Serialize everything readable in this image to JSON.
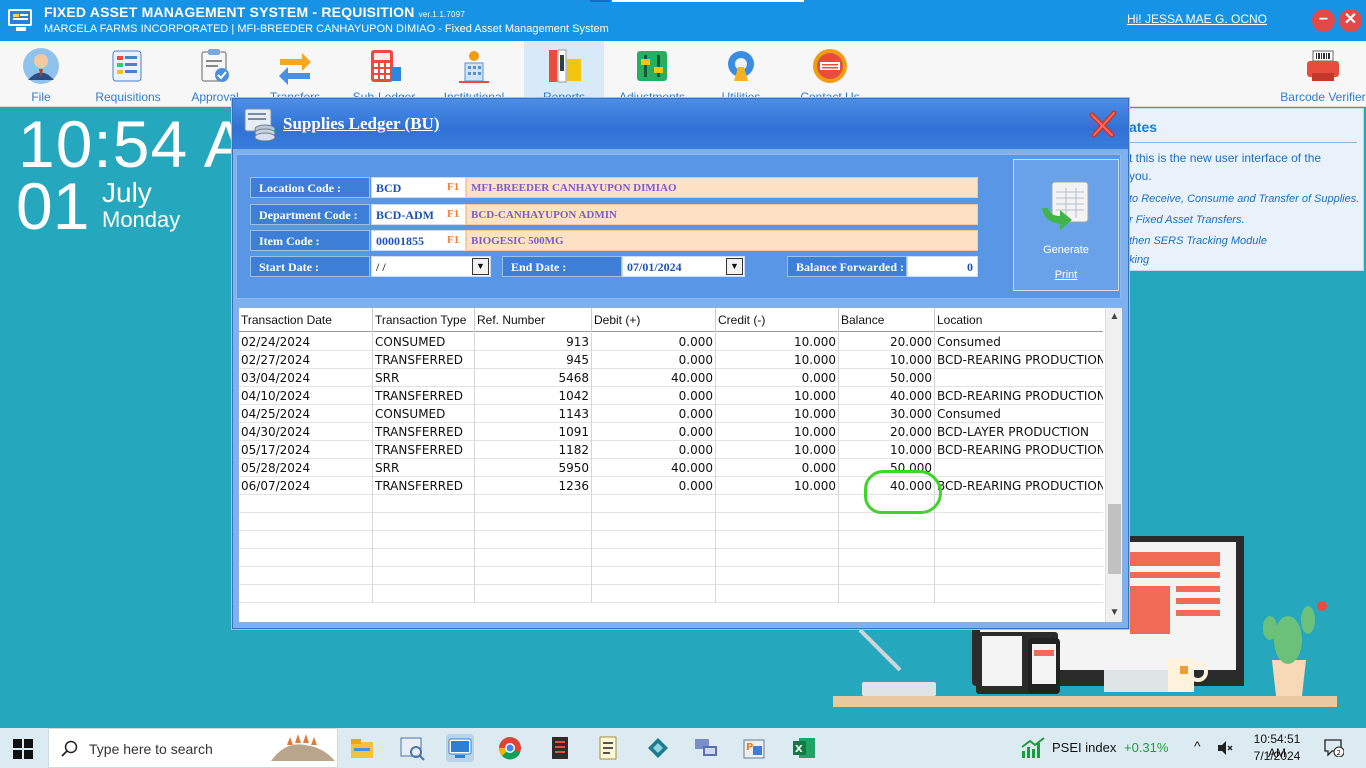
{
  "app": {
    "title": "FIXED ASSET MANAGEMENT SYSTEM - REQUISITION",
    "version": "ver.1.1.7097",
    "subtitle": "MARCELA FARMS INCORPORATED | MFI-BREEDER CANHAYUPON DIMIAO - Fixed Asset Management System",
    "user_greeting": "Hi! JESSA MAE G. OCNO",
    "minimize_label": "−",
    "close_label": "✕"
  },
  "ribbon": [
    {
      "label": "File",
      "icon": "user-icon"
    },
    {
      "label": "Requisitions",
      "icon": "requisition-icon"
    },
    {
      "label": "Approval",
      "icon": "approval-icon"
    },
    {
      "label": "Transfers",
      "icon": "transfer-icon"
    },
    {
      "label": "Sub-Ledger",
      "icon": "calculator-icon"
    },
    {
      "label": "Institutional",
      "icon": "institution-icon"
    },
    {
      "label": "Reports",
      "icon": "reports-icon",
      "active": true
    },
    {
      "label": "Adjustments",
      "icon": "adjustments-icon"
    },
    {
      "label": "Utilities",
      "icon": "utilities-icon"
    },
    {
      "label": "Contact Us",
      "icon": "contact-icon"
    },
    {
      "label": "Barcode Verifier",
      "icon": "barcode-printer-icon"
    }
  ],
  "clock": {
    "time": "10:54 A",
    "day": "01",
    "month": "July",
    "weekday": "Monday"
  },
  "updates": {
    "title": "ates",
    "lines": [
      "t this is the new user interface of  the",
      "you.",
      "to Receive, Consume and Transfer of Supplies.",
      "r Fixed Asset Transfers.",
      "then SERS Tracking Module",
      "king"
    ]
  },
  "dialog": {
    "title": "Supplies Ledger (BU)",
    "location": {
      "label": "Location Code :",
      "code": "BCD",
      "key": "F1",
      "desc": "MFI-BREEDER CANHAYUPON DIMIAO"
    },
    "department": {
      "label": "Department Code :",
      "code": "BCD-ADM",
      "key": "F1",
      "desc": "BCD-CANHAYUPON ADMIN"
    },
    "item": {
      "label": "Item Code :",
      "code": "00001855",
      "key": "F1",
      "desc": "BIOGESIC 500MG"
    },
    "start_date": {
      "label": "Start Date :",
      "value": " /  /"
    },
    "end_date": {
      "label": "End Date :",
      "value": "07/01/2024"
    },
    "balance_forwarded": {
      "label": "Balance Forwarded :",
      "value": "0"
    },
    "generate_label": "Generate",
    "print_label": "Print"
  },
  "grid": {
    "columns": [
      "Transaction Date",
      "Transaction Type",
      "Ref. Number",
      "Debit (+)",
      "Credit (-)",
      "Balance",
      "Location"
    ],
    "rows": [
      [
        "02/24/2024",
        "CONSUMED",
        "913",
        "0.000",
        "10.000",
        "20.000",
        "Consumed"
      ],
      [
        "02/27/2024",
        "TRANSFERRED",
        "945",
        "0.000",
        "10.000",
        "10.000",
        "BCD-REARING PRODUCTION"
      ],
      [
        "03/04/2024",
        "SRR",
        "5468",
        "40.000",
        "0.000",
        "50.000",
        ""
      ],
      [
        "04/10/2024",
        "TRANSFERRED",
        "1042",
        "0.000",
        "10.000",
        "40.000",
        "BCD-REARING PRODUCTION"
      ],
      [
        "04/25/2024",
        "CONSUMED",
        "1143",
        "0.000",
        "10.000",
        "30.000",
        "Consumed"
      ],
      [
        "04/30/2024",
        "TRANSFERRED",
        "1091",
        "0.000",
        "10.000",
        "20.000",
        "BCD-LAYER PRODUCTION"
      ],
      [
        "05/17/2024",
        "TRANSFERRED",
        "1182",
        "0.000",
        "10.000",
        "10.000",
        "BCD-REARING PRODUCTION"
      ],
      [
        "05/28/2024",
        "SRR",
        "5950",
        "40.000",
        "0.000",
        "50.000",
        ""
      ],
      [
        "06/07/2024",
        "TRANSFERRED",
        "1236",
        "0.000",
        "10.000",
        "40.000",
        "BCD-REARING PRODUCTION"
      ]
    ],
    "empty_rows": 6
  },
  "taskbar": {
    "search_placeholder": "Type here to search",
    "apps": [
      "file-explorer-icon",
      "image-viewer-icon",
      "fams-app-icon",
      "chrome-icon",
      "app-red-icon",
      "notes-icon",
      "network-icon",
      "remote-desktop-icon",
      "powerbuilder-icon",
      "excel-icon"
    ],
    "ticker_name": "PSEI index",
    "ticker_value": "+0.31%",
    "chevron": "^",
    "time": "10:54:51 AM",
    "date": "7/1/2024",
    "notifications": "2"
  },
  "colors": {
    "accent": "#1793e6",
    "desktop": "#25a7be",
    "highlight": "#3fd42a"
  }
}
